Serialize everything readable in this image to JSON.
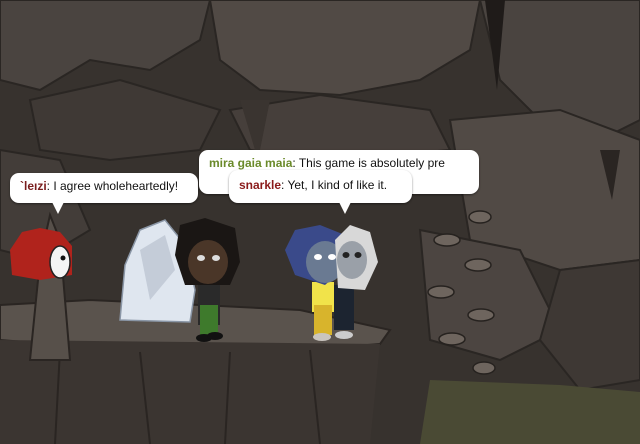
{
  "game": "Gaia Online cave scene",
  "chat": [
    {
      "speaker": "`leızi",
      "message": "I agree wholeheartedly!",
      "name_color": "#7a1e1e"
    },
    {
      "speaker": "mira gaia maia",
      "message": "This game is absolutely pre",
      "name_color": "#6a8a2a"
    },
    {
      "speaker": "snarkle",
      "message": "Yet, I kind of like it.",
      "name_color": "#8a1a1a"
    }
  ],
  "colors": {
    "cave_dark": "#2d2a27",
    "cave_mid": "#4a4440",
    "cave_light": "#6b625b",
    "ledge": "#57504a"
  },
  "characters": [
    {
      "name": "red-haired-avatar",
      "hair": "#b0231c"
    },
    {
      "name": "crystal-rock"
    },
    {
      "name": "dark-haired-avatar",
      "hair": "#1a1614"
    },
    {
      "name": "blue-haired-avatar",
      "hair": "#3a4a8a"
    },
    {
      "name": "white-haired-avatar",
      "hair": "#d8d8d8"
    }
  ]
}
